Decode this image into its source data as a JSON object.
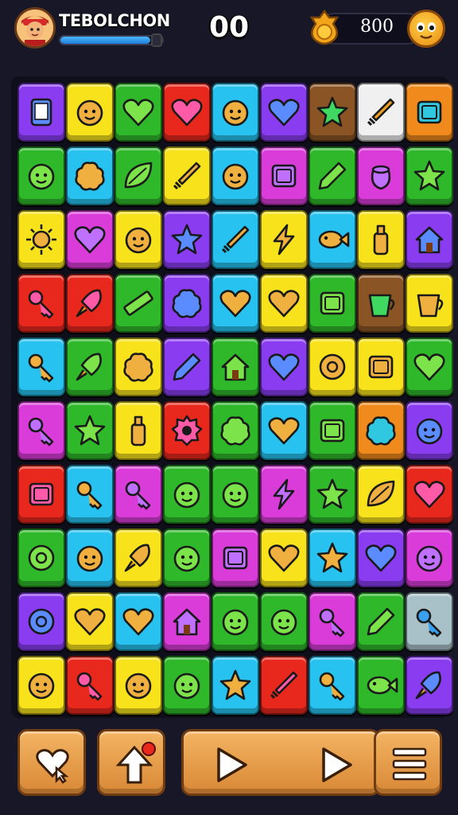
{
  "hud": {
    "player_name": "TEBOLCHON",
    "xp_progress": 0.88,
    "score": "00",
    "coins": "800",
    "icons": {
      "avatar": "player-avatar",
      "coin": "gold-coin-icon",
      "menu_face": "face-menu-icon"
    }
  },
  "board": {
    "columns": 9,
    "rows": 10,
    "tiles": [
      [
        "purple",
        "phone"
      ],
      [
        "yellow",
        "face"
      ],
      [
        "green",
        "heart"
      ],
      [
        "red",
        "heart"
      ],
      [
        "cyan",
        "face"
      ],
      [
        "purple",
        "heart"
      ],
      [
        "brown",
        "star"
      ],
      [
        "white",
        "sword"
      ],
      [
        "orange",
        "box"
      ],
      [
        "green",
        "face"
      ],
      [
        "cyan",
        "blob"
      ],
      [
        "green",
        "leaf"
      ],
      [
        "yellow",
        "sword"
      ],
      [
        "cyan",
        "face"
      ],
      [
        "pink",
        "box"
      ],
      [
        "green",
        "pencil"
      ],
      [
        "pink",
        "pot"
      ],
      [
        "green",
        "star"
      ],
      [
        "yellow",
        "sun"
      ],
      [
        "pink",
        "heart"
      ],
      [
        "yellow",
        "face"
      ],
      [
        "purple",
        "star"
      ],
      [
        "cyan",
        "sword"
      ],
      [
        "yellow",
        "bolt"
      ],
      [
        "cyan",
        "fish"
      ],
      [
        "yellow",
        "bottle"
      ],
      [
        "purple",
        "house"
      ],
      [
        "red",
        "key"
      ],
      [
        "red",
        "rocket"
      ],
      [
        "green",
        "ruler"
      ],
      [
        "purple",
        "blob"
      ],
      [
        "cyan",
        "heart"
      ],
      [
        "yellow",
        "heart"
      ],
      [
        "green",
        "box"
      ],
      [
        "brown",
        "cup"
      ],
      [
        "yellow",
        "cup"
      ],
      [
        "cyan",
        "key"
      ],
      [
        "green",
        "rocket"
      ],
      [
        "yellow",
        "blob"
      ],
      [
        "purple",
        "pencil"
      ],
      [
        "green",
        "house"
      ],
      [
        "purple",
        "heart"
      ],
      [
        "yellow",
        "circle"
      ],
      [
        "yellow",
        "box"
      ],
      [
        "green",
        "heart"
      ],
      [
        "pink",
        "key"
      ],
      [
        "green",
        "star"
      ],
      [
        "yellow",
        "bottle"
      ],
      [
        "red",
        "gear"
      ],
      [
        "green",
        "blob"
      ],
      [
        "cyan",
        "heart"
      ],
      [
        "green",
        "box"
      ],
      [
        "orange",
        "blob"
      ],
      [
        "purple",
        "face"
      ],
      [
        "red",
        "box"
      ],
      [
        "cyan",
        "key"
      ],
      [
        "pink",
        "key"
      ],
      [
        "green",
        "face"
      ],
      [
        "green",
        "face"
      ],
      [
        "pink",
        "bolt"
      ],
      [
        "green",
        "star"
      ],
      [
        "yellow",
        "leaf"
      ],
      [
        "red",
        "heart"
      ],
      [
        "green",
        "circle"
      ],
      [
        "cyan",
        "face"
      ],
      [
        "yellow",
        "rocket"
      ],
      [
        "green",
        "face"
      ],
      [
        "pink",
        "box"
      ],
      [
        "yellow",
        "heart"
      ],
      [
        "cyan",
        "star"
      ],
      [
        "purple",
        "heart"
      ],
      [
        "pink",
        "face"
      ],
      [
        "purple",
        "circle"
      ],
      [
        "yellow",
        "heart"
      ],
      [
        "cyan",
        "heart"
      ],
      [
        "pink",
        "house"
      ],
      [
        "green",
        "face"
      ],
      [
        "green",
        "face"
      ],
      [
        "pink",
        "key"
      ],
      [
        "green",
        "pencil"
      ],
      [
        "grey",
        "key"
      ],
      [
        "yellow",
        "face"
      ],
      [
        "red",
        "key"
      ],
      [
        "yellow",
        "face"
      ],
      [
        "green",
        "face"
      ],
      [
        "cyan",
        "star"
      ],
      [
        "red",
        "sword"
      ],
      [
        "cyan",
        "key"
      ],
      [
        "green",
        "fish"
      ],
      [
        "purple",
        "rocket"
      ]
    ],
    "colors": {
      "purple": "#8a3cf0",
      "yellow": "#f7e21c",
      "green": "#2fb82a",
      "red": "#e8281c",
      "cyan": "#27c2f0",
      "pink": "#d93cd9",
      "brown": "#8a5424",
      "white": "#f0f0f0",
      "orange": "#f08a1c",
      "grey": "#a8c0c8"
    }
  },
  "toolbar": {
    "buttons": [
      {
        "name": "hint-button",
        "icon": "heart-cursor-icon"
      },
      {
        "name": "shuffle-button",
        "icon": "up-arrow-icon"
      },
      {
        "name": "play-button",
        "icon": "play-icon"
      },
      {
        "name": "menu-button",
        "icon": "hamburger-menu-icon"
      }
    ]
  },
  "accent": "#f3b462"
}
